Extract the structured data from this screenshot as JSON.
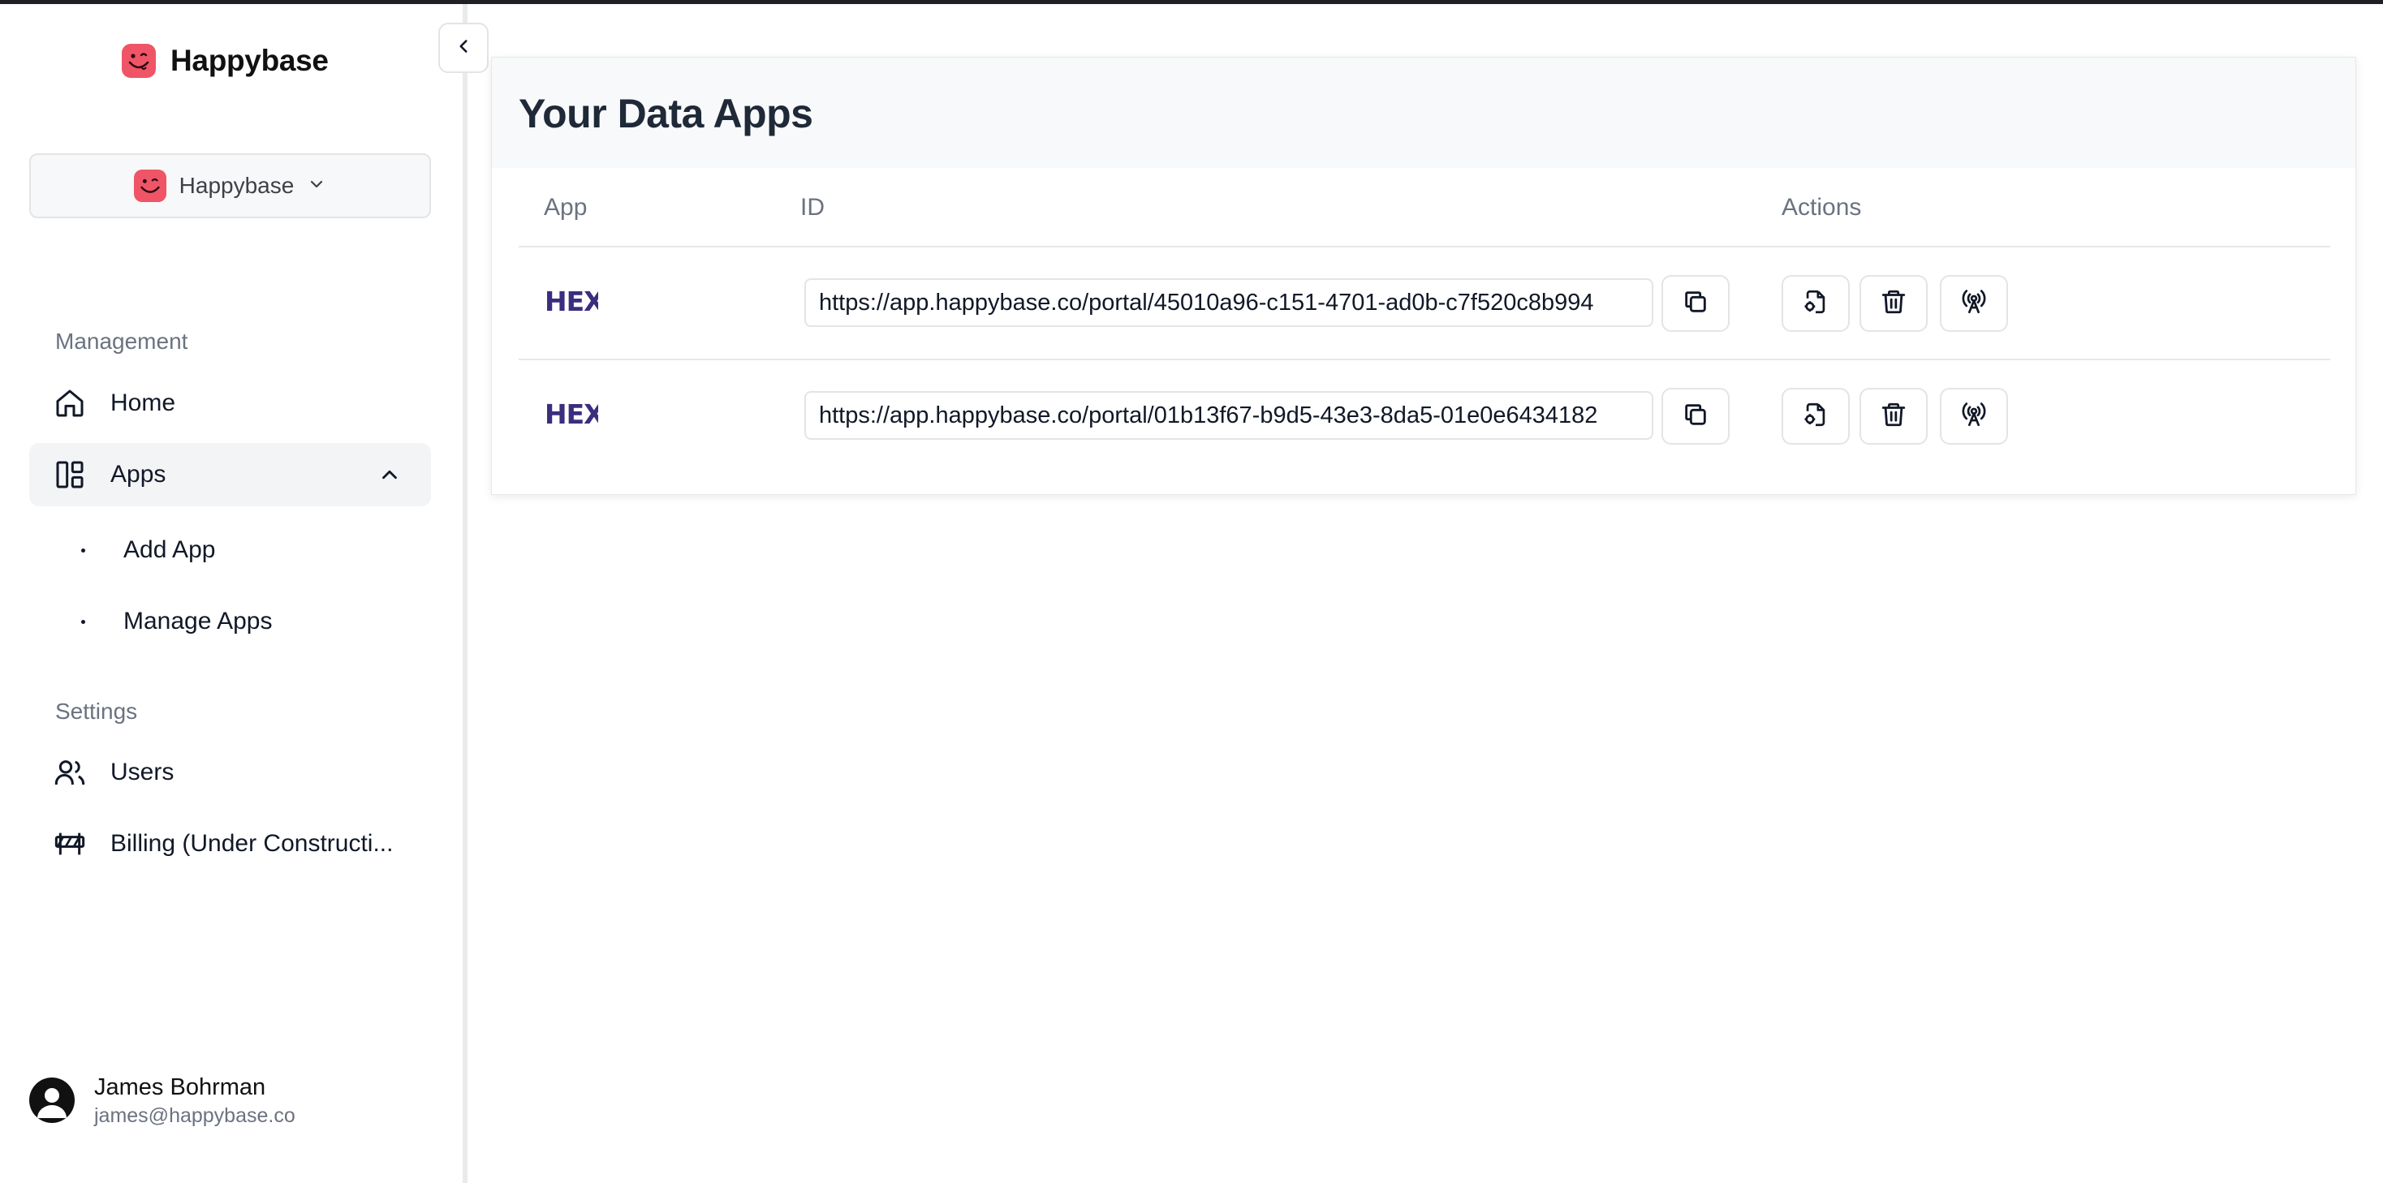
{
  "brand": {
    "name": "Happybase"
  },
  "workspace": {
    "name": "Happybase"
  },
  "sidebar": {
    "management_label": "Management",
    "settings_label": "Settings",
    "items": {
      "home": "Home",
      "apps": "Apps",
      "add_app": "Add App",
      "manage_apps": "Manage Apps",
      "users": "Users",
      "billing": "Billing (Under Constructi..."
    }
  },
  "user": {
    "name": "James Bohrman",
    "email": "james@happybase.co"
  },
  "main": {
    "title": "Your Data Apps",
    "columns": {
      "app": "App",
      "id": "ID",
      "actions": "Actions"
    },
    "rows": [
      {
        "app": "HEX",
        "url": "https://app.happybase.co/portal/45010a96-c151-4701-ad0b-c7f520c8b994"
      },
      {
        "app": "HEX",
        "url": "https://app.happybase.co/portal/01b13f67-b9d5-43e3-8da5-01e0e6434182"
      }
    ]
  },
  "colors": {
    "brand": "#ef5566",
    "hex_logo": "#3b2e7e"
  },
  "icons": [
    "chevron-left-icon",
    "chevron-down-icon",
    "home-icon",
    "apps-layout-icon",
    "chevron-up-icon",
    "users-icon",
    "road-barrier-icon",
    "user-avatar-icon",
    "copy-icon",
    "file-settings-icon",
    "trash-icon",
    "broadcast-icon"
  ]
}
